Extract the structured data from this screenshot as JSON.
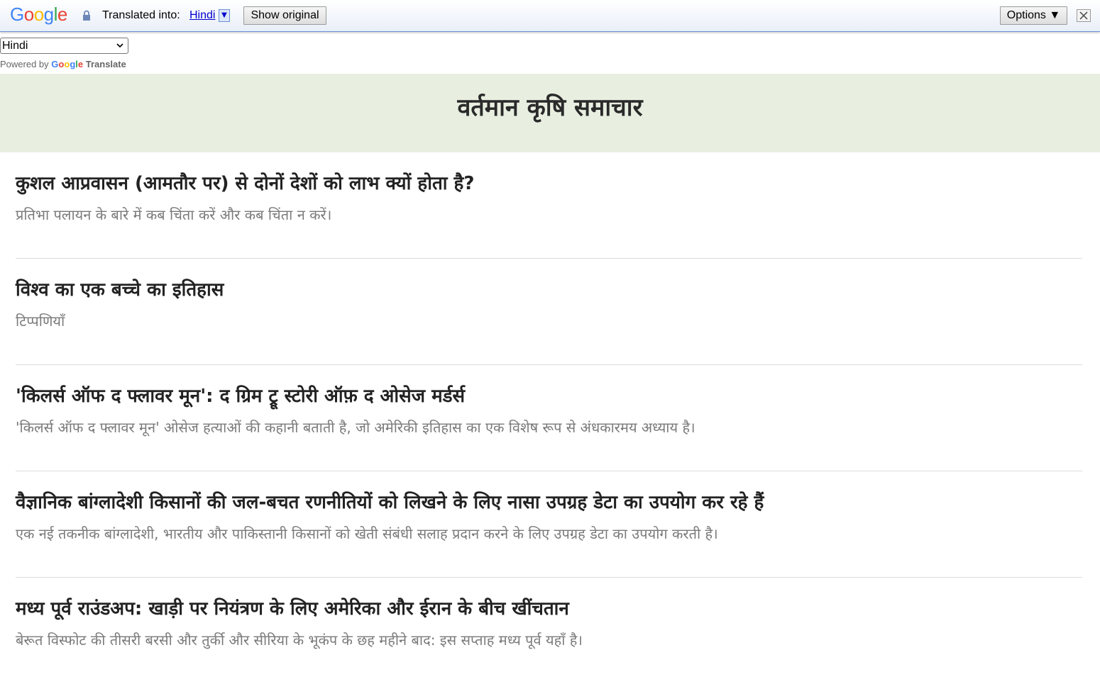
{
  "translate_bar": {
    "logo_letters": [
      "G",
      "o",
      "o",
      "g",
      "l",
      "e"
    ],
    "translated_into_label": "Translated into:",
    "language_link": "Hindi",
    "language_arrow": "▼",
    "show_original_label": "Show original",
    "options_label": "Options ▼",
    "lock_icon": "lock-icon",
    "close_icon": "close-icon"
  },
  "language_select": {
    "selected": "Hindi"
  },
  "powered_by": {
    "prefix": "Powered by",
    "google": [
      "G",
      "o",
      "o",
      "g",
      "l",
      "e"
    ],
    "translate": "Translate"
  },
  "header": {
    "title": "वर्तमान कृषि समाचार",
    "background": "#e8efe1"
  },
  "articles": [
    {
      "title": "कुशल आप्रवासन (आमतौर पर) से दोनों देशों को लाभ क्यों होता है?",
      "summary": "प्रतिभा पलायन के बारे में कब चिंता करें और कब चिंता न करें।"
    },
    {
      "title": "विश्व का एक बच्चे का इतिहास",
      "summary": "टिप्पणियाँ"
    },
    {
      "title": "'किलर्स ऑफ द फ्लावर मून': द ग्रिम ट्रू स्टोरी ऑफ़ द ओसेज मर्डर्स",
      "summary": "'किलर्स ऑफ द फ्लावर मून' ओसेज हत्याओं की कहानी बताती है, जो अमेरिकी इतिहास का एक विशेष रूप से अंधकारमय अध्याय है।"
    },
    {
      "title": "वैज्ञानिक बांग्लादेशी किसानों की जल-बचत रणनीतियों को लिखने के लिए नासा उपग्रह डेटा का उपयोग कर रहे हैं",
      "summary": "एक नई तकनीक बांग्लादेशी, भारतीय और पाकिस्तानी किसानों को खेती संबंधी सलाह प्रदान करने के लिए उपग्रह डेटा का उपयोग करती है।"
    },
    {
      "title": "मध्य पूर्व राउंडअप: खाड़ी पर नियंत्रण के लिए अमेरिका और ईरान के बीच खींचतान",
      "summary": "बेरूत विस्फोट की तीसरी बरसी और तुर्की और सीरिया के भूकंप के छह महीने बाद: इस सप्ताह मध्य पूर्व यहाँ है।"
    }
  ]
}
